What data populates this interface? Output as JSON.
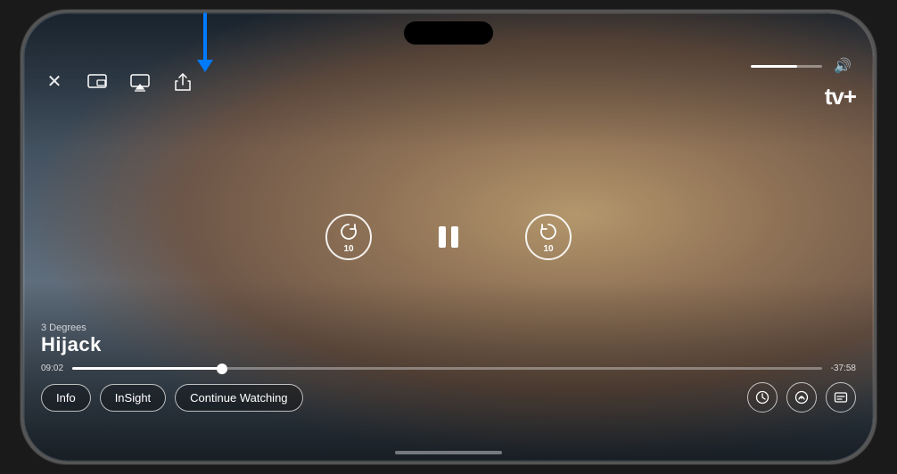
{
  "phone": {
    "top_bar": {
      "close_label": "✕",
      "picture_in_picture_icon": "⧉",
      "airplay_icon": "▲",
      "share_icon": "↑",
      "volume_icon": "🔊",
      "volume_percent": 65
    },
    "brand": {
      "apple_icon": "",
      "tv_plus_label": "tv+"
    },
    "arrow_indicator": {
      "color": "#007AFF"
    },
    "center_controls": {
      "skip_back_seconds": "10",
      "skip_forward_seconds": "10",
      "pause_icon": "⏸"
    },
    "content": {
      "episode_label": "3 Degrees",
      "show_title": "Hijack",
      "time_elapsed": "09:02",
      "time_remaining": "-37:58",
      "progress_percent": 20
    },
    "extra_controls": [
      {
        "icon": "⏱",
        "label": "speed",
        "id": "speed-btn"
      },
      {
        "icon": "🎙",
        "label": "audio",
        "id": "audio-btn"
      },
      {
        "icon": "💬",
        "label": "subtitles",
        "id": "subtitles-btn"
      }
    ],
    "pill_buttons": [
      {
        "label": "Info",
        "id": "info-btn"
      },
      {
        "label": "InSight",
        "id": "insight-btn"
      },
      {
        "label": "Continue Watching",
        "id": "continue-btn"
      }
    ]
  }
}
